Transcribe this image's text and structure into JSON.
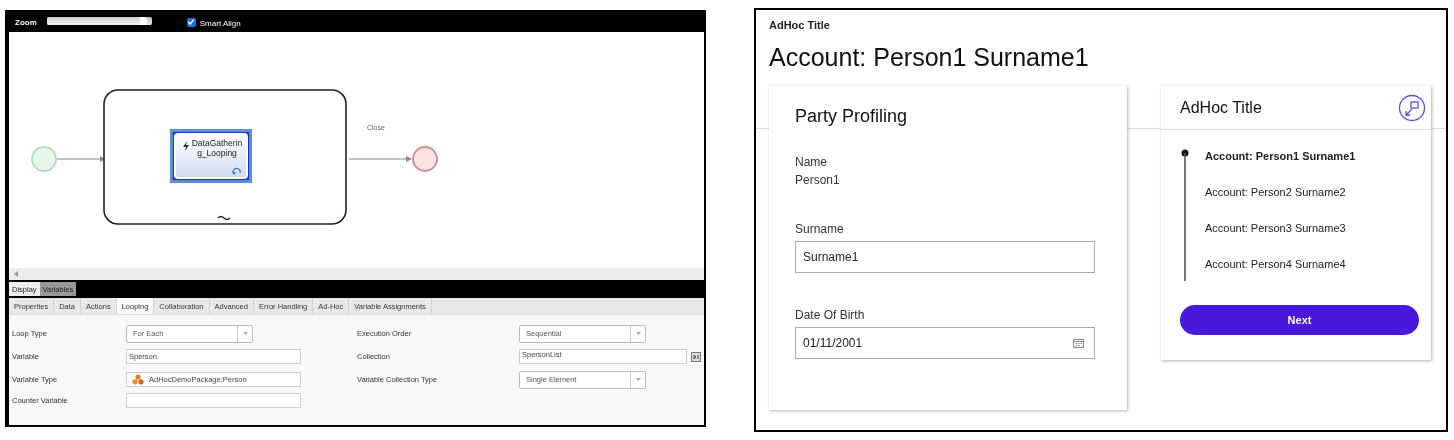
{
  "designer": {
    "toolbar": {
      "zoom_label": "Zoom",
      "zoom": {
        "level": 0.95
      },
      "smart_align": {
        "label": "Smart Align",
        "checked": true
      }
    },
    "diagram": {
      "task": {
        "label": "DataGathering_Looping",
        "selected": true
      },
      "edge_label": "Close"
    },
    "view_tabs": [
      {
        "label": "Display",
        "selected": true
      },
      {
        "label": "Variables",
        "selected": false
      }
    ],
    "property_tabs": [
      {
        "label": "Properties",
        "selected": false
      },
      {
        "label": "Data",
        "selected": false
      },
      {
        "label": "Actions",
        "selected": false
      },
      {
        "label": "Looping",
        "selected": true
      },
      {
        "label": "Collaboration",
        "selected": false
      },
      {
        "label": "Advanced",
        "selected": false
      },
      {
        "label": "Error Handling",
        "selected": false
      },
      {
        "label": "Ad-Hoc",
        "selected": false
      },
      {
        "label": "Variable Assignments",
        "selected": false
      }
    ],
    "left_fields": [
      {
        "label": "Loop Type",
        "kind": "select",
        "value": "For Each"
      },
      {
        "label": "Variable",
        "kind": "input",
        "value": "Sperson"
      },
      {
        "label": "Variable Type",
        "kind": "typed",
        "value": "AdHocDemoPackage:Person"
      },
      {
        "label": "Counter Variable",
        "kind": "input"
      }
    ],
    "right_fields": [
      {
        "label": "Execution Order",
        "kind": "select",
        "value": "Sequential"
      },
      {
        "label": "Collection",
        "kind": "picker",
        "value": "SpersonList"
      },
      {
        "label": "Variable Collection Type",
        "kind": "select",
        "value": "Single Element"
      }
    ]
  },
  "form": {
    "header": "AdHoc Title",
    "title": "Account: Person1 Surname1",
    "card": {
      "title": "Party Profiling",
      "name_label": "Name",
      "name_value": "Person1",
      "fields": [
        {
          "label": "Surname",
          "kind": "text",
          "value": "Surname1"
        },
        {
          "label": "Date Of Birth",
          "kind": "date",
          "value": "01/11/2001"
        }
      ]
    },
    "side": {
      "title": "AdHoc Title",
      "steps": [
        {
          "label": "Account: Person1 Surname1",
          "selected": true
        },
        {
          "label": "Account: Person2 Surname2",
          "selected": false
        },
        {
          "label": "Account: Person3 Surname3",
          "selected": false
        },
        {
          "label": "Account: Person4 Surname4",
          "selected": false
        }
      ],
      "button": "Next"
    }
  }
}
